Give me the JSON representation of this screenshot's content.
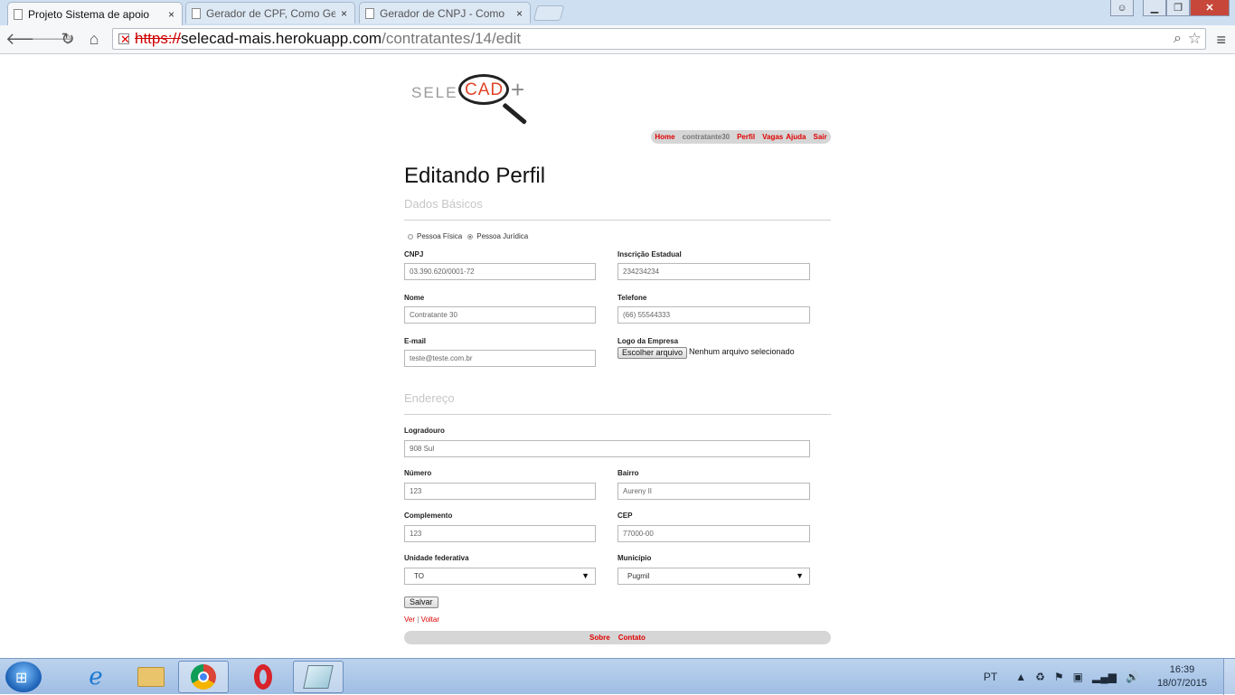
{
  "browser": {
    "tabs": [
      {
        "title": "Projeto Sistema de apoio",
        "active": true
      },
      {
        "title": "Gerador de CPF, Como Ge",
        "active": false
      },
      {
        "title": "Gerador de CNPJ - Como",
        "active": false
      }
    ],
    "close_glyph": "×",
    "url_scheme": "https://",
    "url_host": "selecad-mais.herokuapp.com",
    "url_path": "/contratantes/14/edit"
  },
  "logo": {
    "text_left": "SELE",
    "text_mid": "CAD",
    "text_right": "+"
  },
  "topnav": {
    "home": "Home",
    "user": "contratante30",
    "perfil": "Perfil",
    "vagas": "Vagas",
    "ajuda": "Ajuda",
    "sair": "Sair"
  },
  "page": {
    "title": "Editando Perfil",
    "section_basic": "Dados Básicos",
    "section_address": "Endereço"
  },
  "person_type": {
    "fisica_label": "Pessoa Física",
    "juridica_label": "Pessoa Jurídica",
    "selected": "juridica"
  },
  "fields": {
    "cnpj": {
      "label": "CNPJ",
      "value": "03.390.620/0001-72"
    },
    "inscricao": {
      "label": "Inscrição Estadual",
      "value": "234234234"
    },
    "nome": {
      "label": "Nome",
      "value": "Contratante 30"
    },
    "telefone": {
      "label": "Telefone",
      "value": "(66) 55544333"
    },
    "email": {
      "label": "E-mail",
      "value": "teste@teste.com.br"
    },
    "logo": {
      "label": "Logo da Empresa",
      "button": "Escolher arquivo",
      "note": "Nenhum arquivo selecionado"
    },
    "logradouro": {
      "label": "Logradouro",
      "value": "908 Sul"
    },
    "numero": {
      "label": "Número",
      "value": "123"
    },
    "bairro": {
      "label": "Bairro",
      "value": "Aureny II"
    },
    "complemento": {
      "label": "Complemento",
      "value": "123"
    },
    "cep": {
      "label": "CEP",
      "value": "77000-00"
    },
    "uf": {
      "label": "Unidade federativa",
      "value": "TO"
    },
    "municipio": {
      "label": "Município",
      "value": "Pugmil"
    }
  },
  "actions": {
    "save": "Salvar",
    "ver": "Ver",
    "sep": "|",
    "voltar": "Voltar"
  },
  "footer": {
    "sobre": "Sobre",
    "contato": "Contato"
  },
  "taskbar": {
    "lang": "PT",
    "time": "16:39",
    "date": "18/07/2015"
  },
  "colors": {
    "link": "#e00000",
    "logo_accent": "#e04428",
    "nav_bg": "#d6d6d6"
  }
}
